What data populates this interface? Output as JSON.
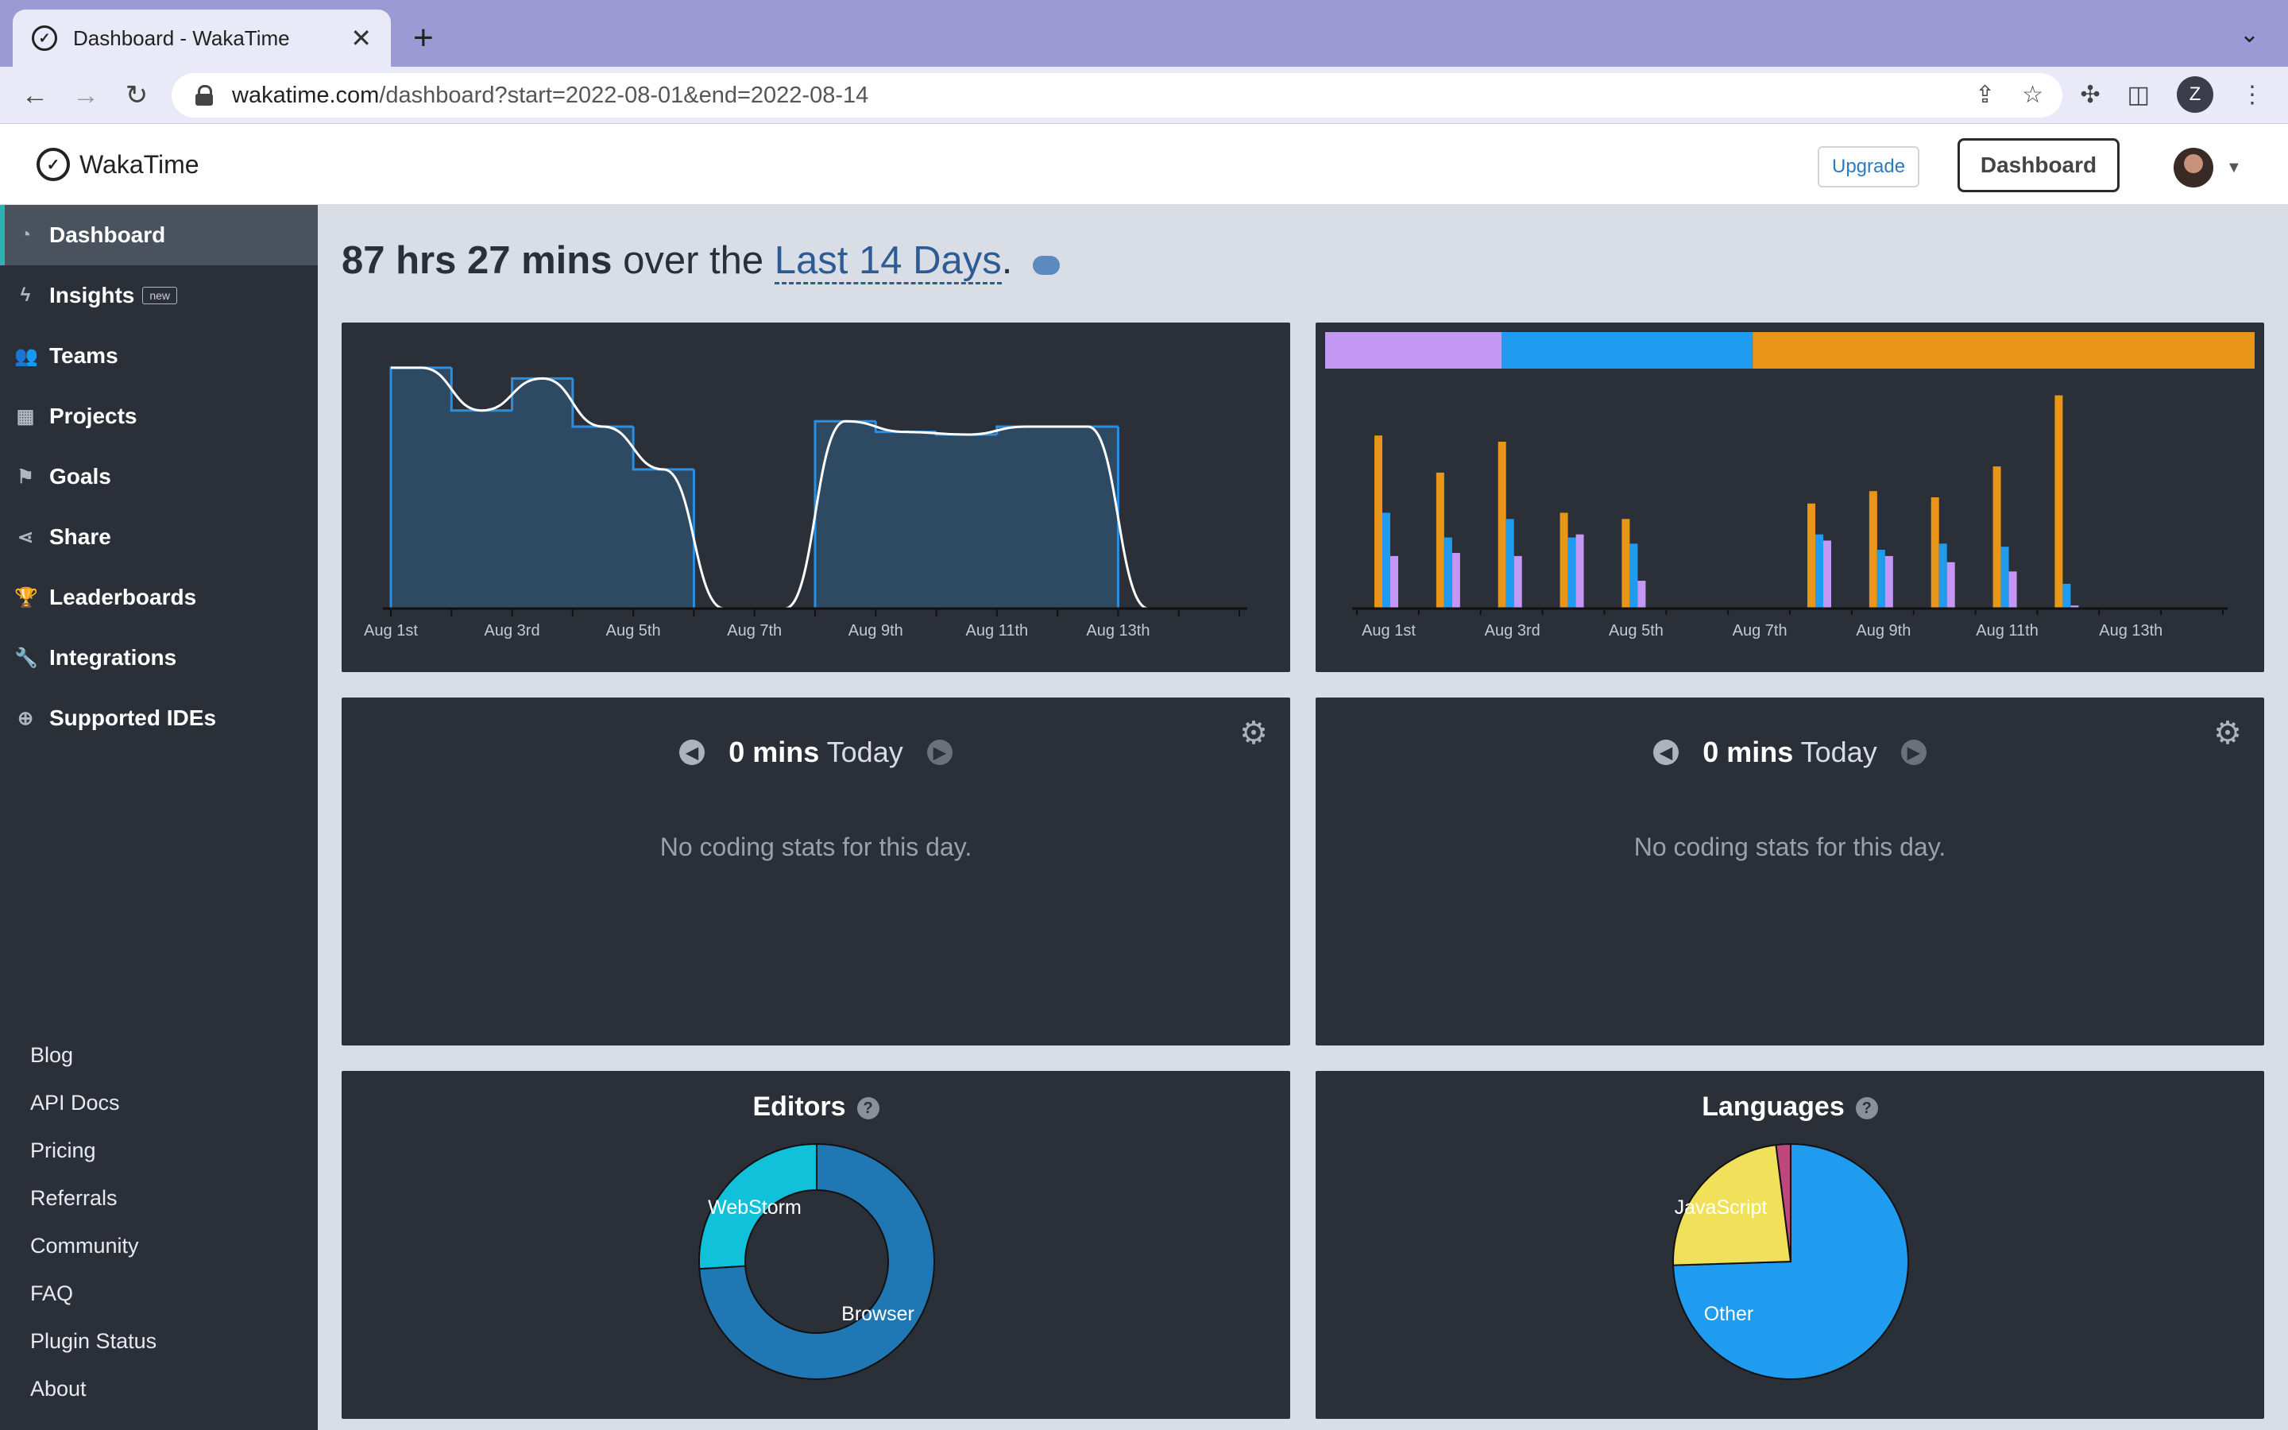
{
  "browser": {
    "tab_title": "Dashboard - WakaTime",
    "tab_close": "✕",
    "new_tab": "+",
    "tab_menu": "⌄",
    "url_host": "wakatime.com",
    "url_path": "/dashboard?start=2022-08-01&end=2022-08-14",
    "profile_initial": "Z"
  },
  "header": {
    "brand": "WakaTime",
    "upgrade": "Upgrade",
    "dashboard": "Dashboard"
  },
  "sidebar": {
    "items": [
      {
        "label": "Dashboard",
        "icon": "dashboard-icon",
        "glyph": "◔"
      },
      {
        "label": "Insights",
        "icon": "bolt-icon",
        "glyph": "ϟ",
        "badge": "new"
      },
      {
        "label": "Teams",
        "icon": "users-icon",
        "glyph": "👥"
      },
      {
        "label": "Projects",
        "icon": "grid-icon",
        "glyph": "▦"
      },
      {
        "label": "Goals",
        "icon": "flag-icon",
        "glyph": "⚑"
      },
      {
        "label": "Share",
        "icon": "share-icon",
        "glyph": "⋖"
      },
      {
        "label": "Leaderboards",
        "icon": "trophy-icon",
        "glyph": "🏆"
      },
      {
        "label": "Integrations",
        "icon": "wrench-icon",
        "glyph": "🔧"
      },
      {
        "label": "Supported IDEs",
        "icon": "plus-circle-icon",
        "glyph": "⊕"
      }
    ],
    "links": [
      "Blog",
      "API Docs",
      "Pricing",
      "Referrals",
      "Community",
      "FAQ",
      "Plugin Status",
      "About"
    ]
  },
  "summary": {
    "total": "87 hrs 27 mins",
    "over_the": "over the",
    "range": "Last 14 Days",
    "period": "."
  },
  "daily_panels": [
    {
      "mins": "0 mins",
      "today": "Today",
      "message": "No coding stats for this day."
    },
    {
      "mins": "0 mins",
      "today": "Today",
      "message": "No coding stats for this day."
    }
  ],
  "pie_panels": {
    "editors_title": "Editors",
    "languages_title": "Languages"
  },
  "colors": {
    "panel": "#2b3038",
    "area_fill": "#2e4a63",
    "step_line": "#2b8fe0",
    "orange": "#e89518",
    "blue": "#1f9bf0",
    "purple": "#c497f5",
    "teal": "#11c1da",
    "dark_blue": "#1f77b4",
    "yellow": "#f0e05a",
    "pink": "#c0477a"
  },
  "chart_data": [
    {
      "type": "area",
      "ticks": [
        "Aug 1st",
        "Aug 3rd",
        "Aug 5th",
        "Aug 7th",
        "Aug 9th",
        "Aug 11th",
        "Aug 13th"
      ],
      "x": [
        "Aug 1",
        "Aug 2",
        "Aug 3",
        "Aug 4",
        "Aug 5",
        "Aug 6",
        "Aug 7",
        "Aug 8",
        "Aug 9",
        "Aug 10",
        "Aug 11",
        "Aug 12",
        "Aug 13",
        "Aug 14"
      ],
      "values": [
        9.0,
        7.4,
        8.6,
        6.8,
        5.2,
        0,
        0,
        7.0,
        6.6,
        6.5,
        6.8,
        6.8,
        0,
        0
      ]
    },
    {
      "type": "bar",
      "stacked_header": [
        {
          "color": "#c497f5",
          "share": 0.19
        },
        {
          "color": "#1f9bf0",
          "share": 0.27
        },
        {
          "color": "#e89518",
          "share": 0.54
        }
      ],
      "ticks": [
        "Aug 1st",
        "Aug 3rd",
        "Aug 5th",
        "Aug 7th",
        "Aug 9th",
        "Aug 11th",
        "Aug 13th"
      ],
      "categories": [
        "Aug 1",
        "Aug 2",
        "Aug 3",
        "Aug 4",
        "Aug 5",
        "Aug 6",
        "Aug 7",
        "Aug 8",
        "Aug 9",
        "Aug 10",
        "Aug 11",
        "Aug 12",
        "Aug 13",
        "Aug 14"
      ],
      "series": [
        {
          "color": "#e89518",
          "values": [
            5.6,
            4.4,
            5.4,
            3.1,
            2.9,
            0,
            0,
            3.4,
            3.8,
            3.6,
            4.6,
            6.9,
            0,
            0
          ]
        },
        {
          "color": "#1f9bf0",
          "values": [
            3.1,
            2.3,
            2.9,
            2.3,
            2.1,
            0,
            0,
            2.4,
            1.9,
            2.1,
            2.0,
            0.8,
            0,
            0
          ]
        },
        {
          "color": "#c497f5",
          "values": [
            1.7,
            1.8,
            1.7,
            2.4,
            0.9,
            0,
            0,
            2.2,
            1.7,
            1.5,
            1.2,
            0.1,
            0,
            0
          ]
        }
      ]
    },
    {
      "type": "pie",
      "variant": "donut",
      "slices": [
        {
          "label": "WebStorm",
          "value": 26,
          "color": "#11c1da"
        },
        {
          "label": "Browser",
          "value": 74,
          "color": "#1f77b4"
        }
      ]
    },
    {
      "type": "pie",
      "slices": [
        {
          "label": "Other",
          "value": 74.5,
          "color": "#1f9bf0"
        },
        {
          "label": "JavaScript",
          "value": 23.5,
          "color": "#f0e05a"
        },
        {
          "label": "",
          "value": 2,
          "color": "#c0477a"
        }
      ]
    }
  ]
}
